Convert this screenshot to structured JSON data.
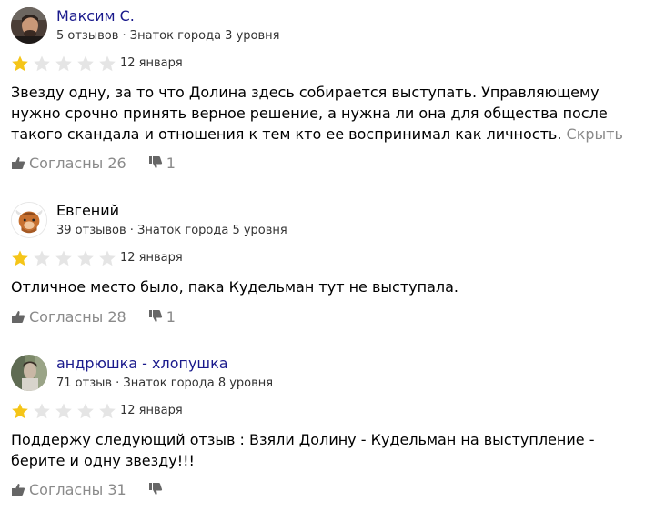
{
  "colors": {
    "star_filled": "#f5c518",
    "star_empty": "#e5e5e5",
    "name_link": "#1a1a8c",
    "secondary_text": "#8a8a8a"
  },
  "reviews": [
    {
      "author": "Максим С.",
      "author_is_link": true,
      "meta": "5 отзывов · Знаток города 3 уровня",
      "rating": 1,
      "rating_max": 5,
      "date": "12 января",
      "text": "Звезду одну, за то что Долина здесь собирается выступать. Управляющему нужно срочно принять верное решение, а нужна ли она для общества после такого скандала и отношения к тем кто ее воспринимал как личность.",
      "collapse_label": "Скрыть",
      "likes_label": "Согласны 26",
      "dislikes_count": "1",
      "avatar_icon": "user-photo-avatar"
    },
    {
      "author": "Евгений",
      "author_is_link": false,
      "meta": "39 отзывов · Знаток города 5 уровня",
      "rating": 1,
      "rating_max": 5,
      "date": "12 января",
      "text": "Отличное место было, пака Кудельман тут не выступала.",
      "likes_label": "Согласны 28",
      "dislikes_count": "1",
      "avatar_icon": "yak-avatar"
    },
    {
      "author": "андрюшка - хлопушка",
      "author_is_link": true,
      "meta": "71 отзыв · Знаток города 8 уровня",
      "rating": 1,
      "rating_max": 5,
      "date": "12 января",
      "text": "Поддержу следующий отзыв : Взяли Долину - Кудельман на выступление - берите и одну звезду!!!",
      "likes_label": "Согласны 31",
      "dislikes_count": "",
      "avatar_icon": "user-photo-avatar"
    }
  ]
}
